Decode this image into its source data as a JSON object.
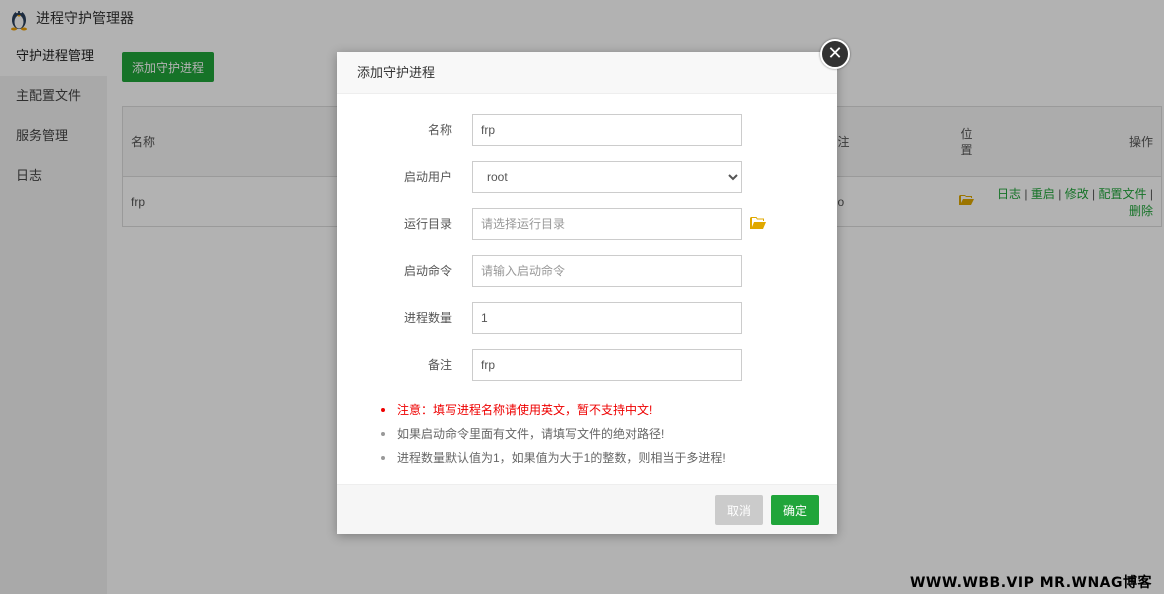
{
  "app": {
    "title": "进程守护管理器"
  },
  "sidebar": {
    "items": [
      {
        "label": "守护进程管理"
      },
      {
        "label": "主配置文件"
      },
      {
        "label": "服务管理"
      },
      {
        "label": "日志"
      }
    ]
  },
  "main": {
    "add_button": "添加守护进程",
    "table": {
      "headers": {
        "name": "名称",
        "note": "注",
        "location_line1": "位",
        "location_line2": "置",
        "ops": "操作"
      },
      "rows": [
        {
          "name": "frp",
          "note": "o",
          "ops": [
            "日志",
            "重启",
            "修改",
            "配置文件",
            "删除"
          ]
        }
      ]
    }
  },
  "modal": {
    "title": "添加守护进程",
    "close_symbol": "✕",
    "fields": {
      "name": {
        "label": "名称",
        "value": "frp"
      },
      "user": {
        "label": "启动用户",
        "value": "root"
      },
      "dir": {
        "label": "运行目录",
        "placeholder": "请选择运行目录"
      },
      "command": {
        "label": "启动命令",
        "placeholder": "请输入启动命令"
      },
      "count": {
        "label": "进程数量",
        "value": "1"
      },
      "note": {
        "label": "备注",
        "value": "frp"
      }
    },
    "tips": [
      "注意：填写进程名称请使用英文，暂不支持中文!",
      "如果启动命令里面有文件，请填写文件的绝对路径!",
      "进程数量默认值为1，如果值为大于1的整数，则相当于多进程!"
    ],
    "buttons": {
      "cancel": "取消",
      "ok": "确定"
    }
  },
  "watermark": "WWW.WBB.VIP  MR.WNAG博客",
  "colors": {
    "accent": "#20a53a",
    "warning": "#ee0000",
    "folder": "#e0a800"
  }
}
